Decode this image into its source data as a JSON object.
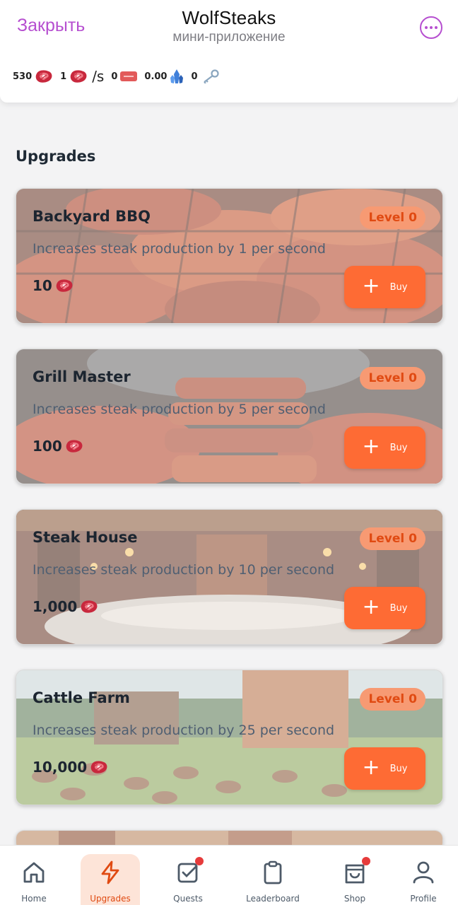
{
  "header": {
    "close_label": "Закрыть",
    "title": "WolfSteaks",
    "subtitle": "мини-приложение",
    "more_icon": "more-horizontal-icon"
  },
  "stats": {
    "steaks": "530",
    "rate": "1",
    "rate_unit": "/s",
    "tickets": "0",
    "crystals": "0.00",
    "keys": "0"
  },
  "main": {
    "section_title": "Upgrades",
    "buy_label": "Buy",
    "cards": [
      {
        "name": "Backyard BBQ",
        "level": "Level 0",
        "description": "Increases steak production by 1 per second",
        "price": "10"
      },
      {
        "name": "Grill Master",
        "level": "Level 0",
        "description": "Increases steak production by 5 per second",
        "price": "100"
      },
      {
        "name": "Steak House",
        "level": "Level 0",
        "description": "Increases steak production by 10 per second",
        "price": "1,000"
      },
      {
        "name": "Cattle Farm",
        "level": "Level 0",
        "description": "Increases steak production by 25 per second",
        "price": "10,000"
      }
    ]
  },
  "nav": {
    "items": [
      {
        "label": "Home",
        "icon": "home-icon"
      },
      {
        "label": "Upgrades",
        "icon": "lightning-icon"
      },
      {
        "label": "Quests",
        "icon": "checkbox-icon"
      },
      {
        "label": "Leaderboard",
        "icon": "clipboard-icon"
      },
      {
        "label": "Shop",
        "icon": "shopping-bag-icon"
      },
      {
        "label": "Profile",
        "icon": "user-icon"
      }
    ]
  },
  "colors": {
    "accent": "#fe6b34",
    "telegram_purple": "#b64fd0",
    "level_badge": "#f79a73",
    "notification": "#e63b3b"
  }
}
